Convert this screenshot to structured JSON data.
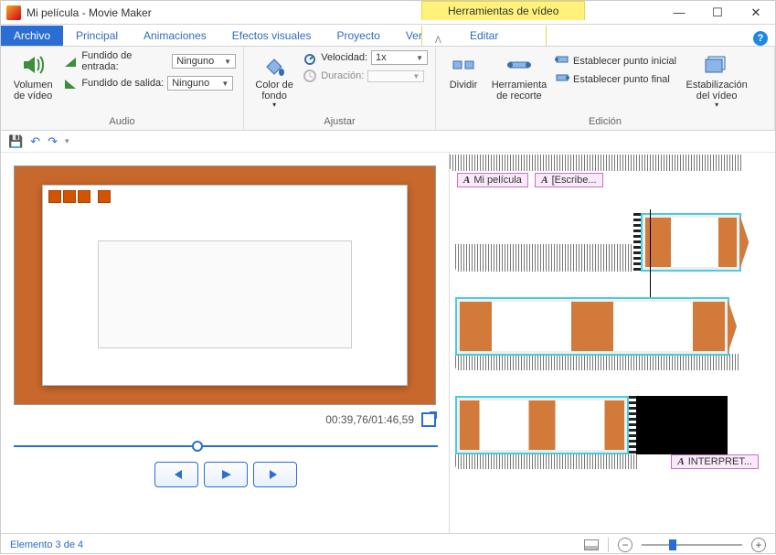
{
  "window": {
    "title": "Mi película - Movie Maker"
  },
  "video_tools_header": "Herramientas de vídeo",
  "tabs": {
    "file": "Archivo",
    "home": "Principal",
    "animations": "Animaciones",
    "visual_effects": "Efectos visuales",
    "project": "Proyecto",
    "view": "Ver",
    "edit": "Editar"
  },
  "ribbon": {
    "audio_group": "Audio",
    "adjust_group": "Ajustar",
    "edit_group": "Edición",
    "video_volume": "Volumen de vídeo",
    "fade_in": "Fundido de entrada:",
    "fade_out": "Fundido de salida:",
    "fade_value": "Ninguno",
    "bg_color": "Color de fondo",
    "speed": "Velocidad:",
    "speed_value": "1x",
    "duration": "Duración:",
    "duration_value": "",
    "split": "Dividir",
    "trim_tool": "Herramienta de recorte",
    "set_start": "Establecer punto inicial",
    "set_end": "Establecer punto final",
    "stabilization": "Estabilización del vídeo"
  },
  "preview": {
    "time": "00:39,76/01:46,59"
  },
  "timeline": {
    "title1": "Mi película",
    "title2": "[Escribe...",
    "title3": "INTERPRET..."
  },
  "status": {
    "element": "Elemento 3 de 4"
  }
}
